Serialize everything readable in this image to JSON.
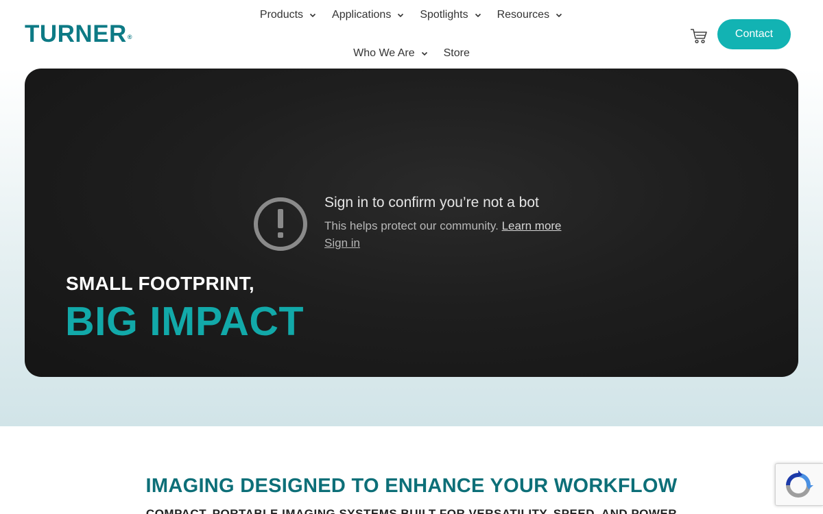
{
  "brand": {
    "logo_text": "TURNER",
    "registered_mark": "®",
    "accent_color": "#12b3b3",
    "logo_color": "#0d7a85"
  },
  "nav": {
    "row1": [
      {
        "label": "Products",
        "has_dropdown": true
      },
      {
        "label": "Applications",
        "has_dropdown": true
      },
      {
        "label": "Spotlights",
        "has_dropdown": true
      },
      {
        "label": "Resources",
        "has_dropdown": true
      }
    ],
    "row2": [
      {
        "label": "Who We Are",
        "has_dropdown": true
      },
      {
        "label": "Store",
        "has_dropdown": false
      }
    ],
    "cart_icon": "shopping-cart-icon",
    "contact_label": "Contact"
  },
  "hero": {
    "bot_notice": {
      "icon": "alert-circle-icon",
      "title": "Sign in to confirm you’re not a bot",
      "description": "This helps protect our community.",
      "learn_more": "Learn more",
      "sign_in": "Sign in"
    },
    "small_heading": "SMALL FOOTPRINT,",
    "big_heading": "BIG IMPACT",
    "big_heading_color": "#12a9a9"
  },
  "section": {
    "title": "IMAGING DESIGNED TO ENHANCE YOUR WORKFLOW",
    "subtitle": "COMPACT, PORTABLE IMAGING SYSTEMS BUILT FOR VERSATILITY, SPEED, AND POWER",
    "title_color": "#0d6f78"
  },
  "recaptcha": {
    "icon": "recaptcha-icon"
  }
}
